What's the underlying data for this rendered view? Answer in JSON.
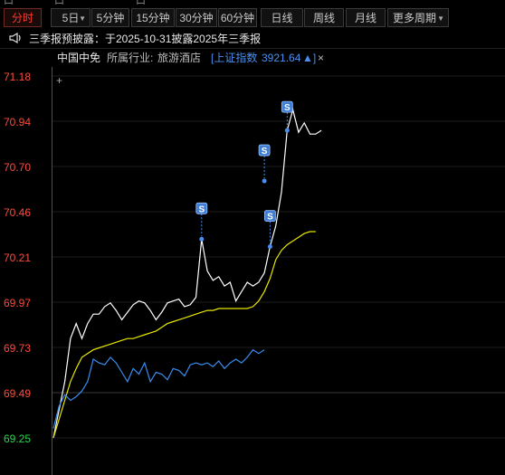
{
  "toolbar": {
    "buttons": [
      "分时",
      "5日",
      "5分钟",
      "15分钟",
      "30分钟",
      "60分钟",
      "日线",
      "周线",
      "月线",
      "更多周期"
    ]
  },
  "notice": {
    "icon": "megaphone-icon",
    "text": "三季报预披露：于2025-10-31披露2025年三季报"
  },
  "stock": {
    "name": "中国中免",
    "industry_label": "所属行业:",
    "industry": "旅游酒店",
    "index_label": "[上证指数",
    "index_value": "3921.64",
    "index_arrow": "▲]",
    "close_symbol": "×"
  },
  "y_axis": {
    "labels": [
      "71.18",
      "70.94",
      "70.70",
      "70.46",
      "70.21",
      "69.97",
      "69.73",
      "69.49",
      "69.25"
    ]
  },
  "colors": {
    "up": "#ff4a3d",
    "down": "#2bd64b",
    "price": "#ffffff",
    "avg": "#e8e800",
    "index": "#3a8df0",
    "accent": "#4a8ff0"
  },
  "chart_data": {
    "type": "line",
    "ylim": [
      69.25,
      71.18
    ],
    "series": [
      {
        "values": [
          69.25,
          69.4,
          69.55,
          69.78,
          69.86,
          69.78,
          69.86,
          69.91,
          69.91,
          69.95,
          69.97,
          69.93,
          69.88,
          69.92,
          69.96,
          69.98,
          69.97,
          69.93,
          69.88,
          69.92,
          69.97,
          69.98,
          69.99,
          69.95,
          69.96,
          70.0,
          70.31,
          70.14,
          70.09,
          70.11,
          70.06,
          70.08,
          69.98,
          70.03,
          70.08,
          70.06,
          70.08,
          70.13,
          70.27,
          70.38,
          70.56,
          70.89,
          71.0,
          70.88,
          70.93,
          70.87,
          70.87,
          70.89
        ]
      },
      {
        "values": [
          69.25,
          69.35,
          69.45,
          69.55,
          69.62,
          69.68,
          69.7,
          69.72,
          69.73,
          69.74,
          69.75,
          69.76,
          69.77,
          69.78,
          69.78,
          69.79,
          69.8,
          69.81,
          69.82,
          69.84,
          69.86,
          69.87,
          69.88,
          69.89,
          69.9,
          69.91,
          69.92,
          69.93,
          69.93,
          69.94,
          69.94,
          69.94,
          69.94,
          69.94,
          69.94,
          69.95,
          69.98,
          70.03,
          70.1,
          70.2,
          70.25,
          70.28,
          70.3,
          70.32,
          70.34,
          70.35,
          70.35
        ]
      },
      {
        "values": [
          69.3,
          69.42,
          69.48,
          69.45,
          69.47,
          69.5,
          69.55,
          69.67,
          69.65,
          69.64,
          69.68,
          69.65,
          69.6,
          69.55,
          69.62,
          69.59,
          69.65,
          69.55,
          69.6,
          69.59,
          69.56,
          69.62,
          69.61,
          69.58,
          69.64,
          69.65,
          69.64,
          69.65,
          69.63,
          69.66,
          69.62,
          69.65,
          69.67,
          69.65,
          69.68,
          69.72,
          69.7,
          69.72
        ]
      }
    ],
    "markers": [
      {
        "label": "S",
        "x_index": 26,
        "value": 70.31
      },
      {
        "label": "S",
        "x_index": 37,
        "value": 70.62
      },
      {
        "label": "S",
        "x_index": 38,
        "value": 70.27
      },
      {
        "label": "S",
        "x_index": 41,
        "value": 70.89
      }
    ]
  }
}
